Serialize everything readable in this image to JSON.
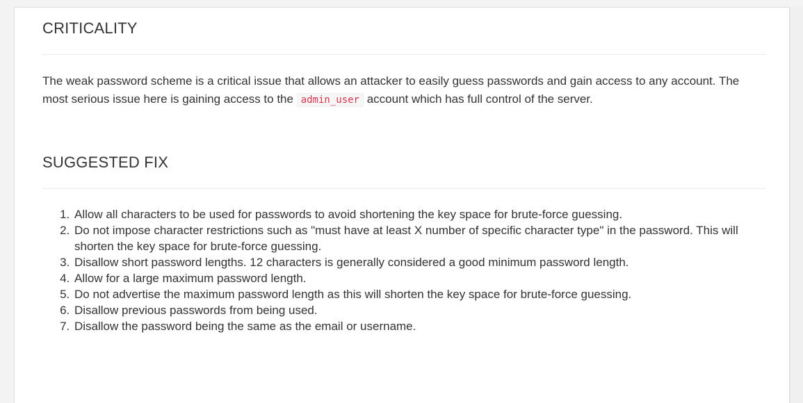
{
  "criticality": {
    "heading": "CRITICALITY",
    "text_before": "The weak password scheme is a critical issue that allows an attacker to easily guess passwords and gain access to any account. The most serious issue here is gaining access to the ",
    "code": "admin_user",
    "text_after": " account which has full control of the server."
  },
  "suggested_fix": {
    "heading": "SUGGESTED FIX",
    "items": [
      "Allow all characters to be used for passwords to avoid shortening the key space for brute-force guessing.",
      "Do not impose character restrictions such as \"must have at least X number of specific character type\" in the password. This will shorten the key space for brute-force guessing.",
      "Disallow short password lengths. 12 characters is generally considered a good minimum password length.",
      "Allow for a large maximum password length.",
      "Do not advertise the maximum password length as this will shorten the key space for brute-force guessing.",
      "Disallow previous passwords from being used.",
      "Disallow the password being the same as the email or username."
    ]
  }
}
